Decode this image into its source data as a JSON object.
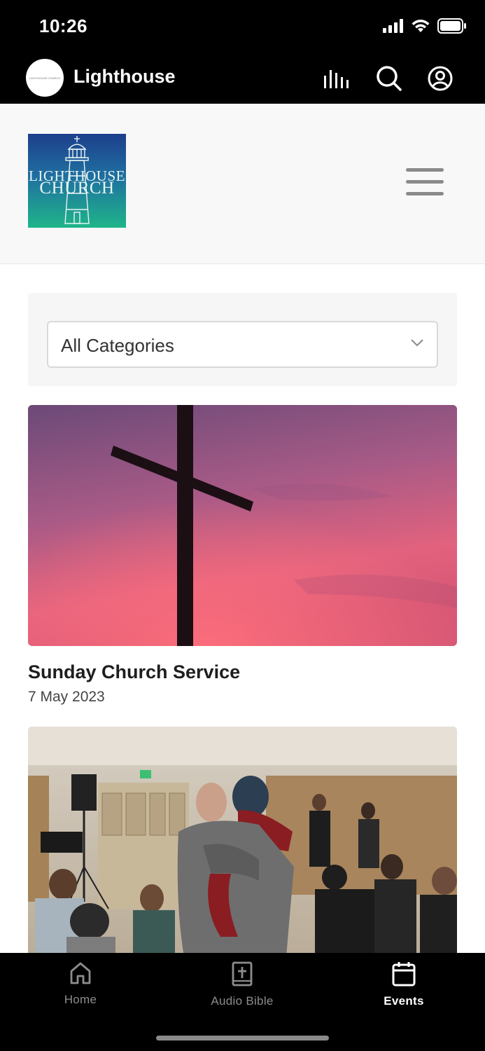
{
  "status_bar": {
    "time": "10:26",
    "icons": [
      "cellular-signal-icon",
      "wifi-icon",
      "battery-icon"
    ]
  },
  "app_header": {
    "title": "Lighthouse",
    "avatar_text": "LIGHTHOUSE CHURCH",
    "icons": [
      "audio-bars-icon",
      "search-icon",
      "account-icon"
    ]
  },
  "site_header": {
    "logo_text_line1": "LIGHTHOUSE",
    "logo_text_line2": "CHURCH",
    "menu_icon": "hamburger-menu-icon"
  },
  "filter": {
    "selected": "All Categories",
    "icon": "chevron-down-icon"
  },
  "events": [
    {
      "title": "Sunday Church Service",
      "date": "7 May 2023",
      "image": "cross-at-sunset-photo"
    },
    {
      "title": "",
      "date": "",
      "image": "congregation-hug-photo"
    }
  ],
  "tab_bar": {
    "tabs": [
      {
        "label": "Home",
        "icon": "home-icon",
        "active": false
      },
      {
        "label": "Audio Bible",
        "icon": "bible-icon",
        "active": false
      },
      {
        "label": "Events",
        "icon": "calendar-icon",
        "active": true
      }
    ]
  },
  "colors": {
    "header_bg": "#000000",
    "site_header_bg": "#f8f8f8",
    "logo_gradient_top": "#1d3f8c",
    "logo_gradient_bottom": "#1fb58a",
    "tab_active": "#ffffff",
    "tab_inactive": "#8d8d8d"
  }
}
